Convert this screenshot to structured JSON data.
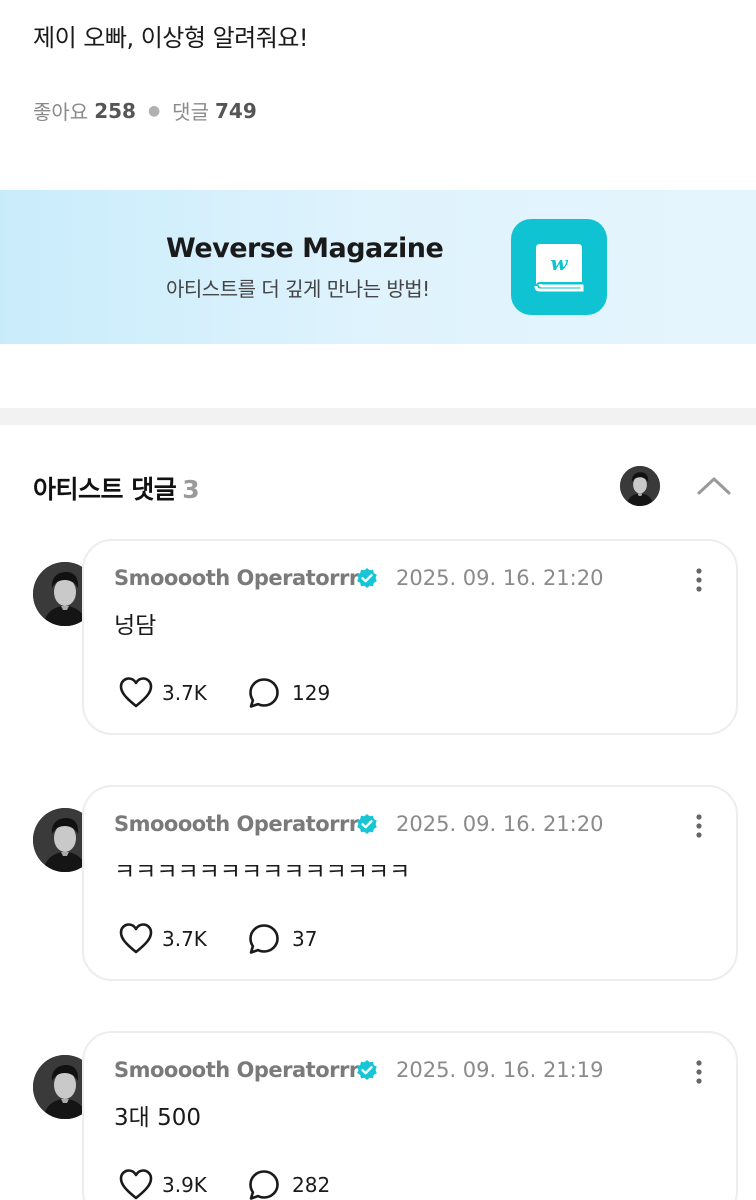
{
  "post": {
    "title": "제이 오빠, 이상형 알려줘요!",
    "likes_label": "좋아요",
    "likes_count": "258",
    "comments_label": "댓글",
    "comments_count": "749"
  },
  "banner": {
    "title": "Weverse Magazine",
    "subtitle": "아티스트를 더 깊게 만나는 방법!",
    "icon": "weverse-magazine-app-icon",
    "accent_color": "#0fc3d3"
  },
  "artist_comments": {
    "title": "아티스트 댓글",
    "count": "3",
    "comments": [
      {
        "author": "Smooooth Operatorrrr",
        "date": "2025. 09. 16. 21:20",
        "text": "넝담",
        "likes": "3.7K",
        "replies": "129"
      },
      {
        "author": "Smooooth Operatorrrr",
        "date": "2025. 09. 16. 21:20",
        "text": "ㅋㅋㅋㅋㅋㅋㅋㅋㅋㅋㅋㅋㅋㅋ",
        "likes": "3.7K",
        "replies": "37"
      },
      {
        "author": "Smooooth Operatorrrr",
        "date": "2025. 09. 16. 21:19",
        "text": "3대 500",
        "likes": "3.9K",
        "replies": "282"
      }
    ]
  },
  "colors": {
    "verified_badge": "#16c5d6",
    "banner_bg": "#d6f0fc"
  }
}
